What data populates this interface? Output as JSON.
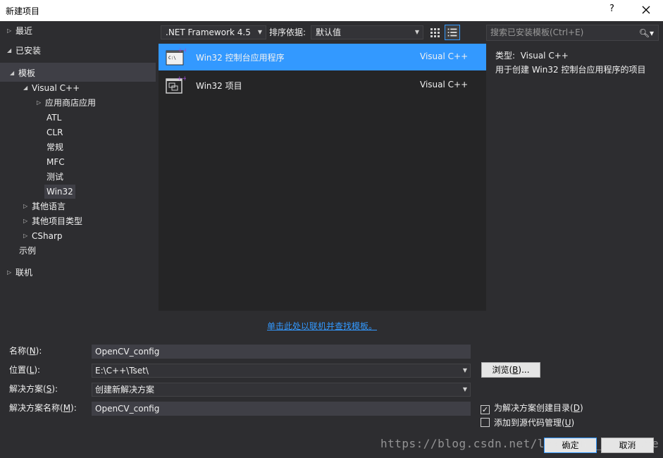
{
  "window": {
    "title": "新建项目",
    "help": "?",
    "close_icon": "close-icon"
  },
  "tree": {
    "recent": "最近",
    "installed": "已安装",
    "templates": "模板",
    "visual_cpp": "Visual C++",
    "store_apps": "应用商店应用",
    "atl": "ATL",
    "clr": "CLR",
    "general": "常规",
    "mfc": "MFC",
    "test": "测试",
    "win32": "Win32",
    "other_languages": "其他语言",
    "other_project_types": "其他项目类型",
    "csharp": "CSharp",
    "samples": "示例",
    "online": "联机"
  },
  "toolbar": {
    "framework": ".NET Framework 4.5",
    "sort_label": "排序依据:",
    "sort_value": "默认值",
    "search_placeholder": "搜索已安装模板(Ctrl+E)"
  },
  "templates": [
    {
      "name": "Win32 控制台应用程序",
      "lang": "Visual C++",
      "selected": true,
      "icon": "console-app-icon"
    },
    {
      "name": "Win32 项目",
      "lang": "Visual C++",
      "selected": false,
      "icon": "win32-project-icon"
    }
  ],
  "description": {
    "type_label": "类型:",
    "type_value": "Visual C++",
    "text": "用于创建 Win32 控制台应用程序的项目"
  },
  "online_link": "单击此处以联机并查找模板。",
  "form": {
    "name_label_pre": "名称(",
    "name_label_key": "N",
    "name_label_post": "):",
    "name_value": "OpenCV_config",
    "location_label_pre": "位置(",
    "location_label_key": "L",
    "location_label_post": "):",
    "location_value": "E:\\C++\\Tset\\",
    "solution_label_pre": "解决方案(",
    "solution_label_key": "S",
    "solution_label_post": "):",
    "solution_value": "创建新解决方案",
    "solution_name_label_pre": "解决方案名称(",
    "solution_name_label_key": "M",
    "solution_name_label_post": "):",
    "solution_name_value": "OpenCV_config",
    "browse_pre": "浏览(",
    "browse_key": "B",
    "browse_post": ")...",
    "create_dir_pre": "为解决方案创建目录(",
    "create_dir_key": "D",
    "create_dir_post": ")",
    "create_dir_checked": true,
    "source_control_pre": "添加到源代码管理(",
    "source_control_key": "U",
    "source_control_post": ")",
    "source_control_checked": false,
    "ok": "确定",
    "cancel": "取消"
  },
  "watermark": "https://blog.csdn.net/learning_for_life",
  "colors": {
    "accent": "#3399ff",
    "background": "#2d2d30",
    "panel": "#252526"
  }
}
